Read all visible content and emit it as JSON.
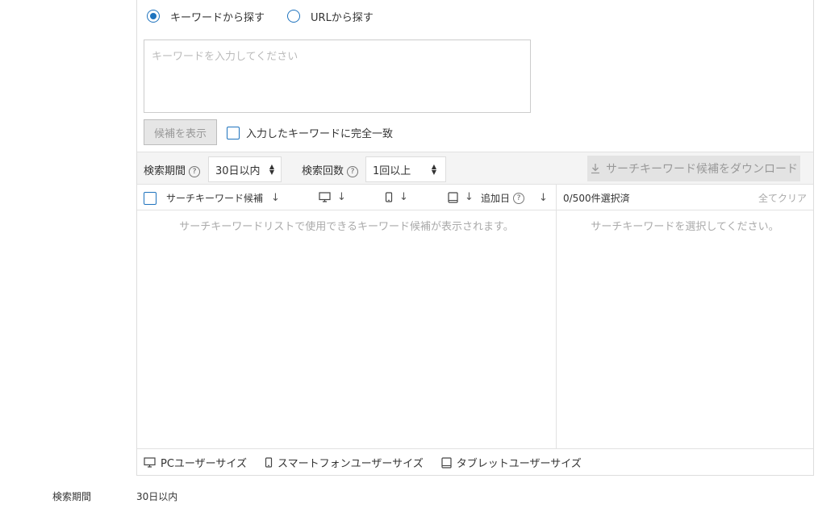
{
  "search_mode": {
    "options": [
      {
        "label": "キーワードから探す",
        "selected": true
      },
      {
        "label": "URLから探す",
        "selected": false
      }
    ]
  },
  "keyword_input": {
    "placeholder": "キーワードを入力してください",
    "value": ""
  },
  "actions": {
    "show_candidates_label": "候補を表示",
    "exact_match_label": "入力したキーワードに完全一致",
    "exact_match_checked": false
  },
  "filters": {
    "period_label": "検索期間",
    "period_value": "30日以内",
    "count_label": "検索回数",
    "count_value": "1回以上",
    "help_glyph": "?",
    "download_label": "サーチキーワード候補をダウンロード"
  },
  "table": {
    "col_keyword": "サーチキーワード候補",
    "col_added": "追加日",
    "sort_glyph": "↓",
    "selected_count": "0/500件選択済",
    "clear_all": "全てクリア",
    "empty_left": "サーチキーワードリストで使用できるキーワード候補が表示されます。",
    "empty_right": "サーチキーワードを選択してください。"
  },
  "legend": {
    "pc": "PCユーザーサイズ",
    "smartphone": "スマートフォンユーザーサイズ",
    "tablet": "タブレットユーザーサイズ"
  },
  "summary": {
    "label": "検索期間",
    "value": "30日以内"
  },
  "colors": {
    "accent": "#1e73be",
    "disabled_text": "#999999",
    "border": "#dddddd"
  },
  "icons": [
    "radio-selected",
    "radio-unselected",
    "checkbox",
    "help-icon",
    "download-icon",
    "desktop-icon",
    "smartphone-icon",
    "tablet-icon",
    "sort-arrow-icon"
  ]
}
